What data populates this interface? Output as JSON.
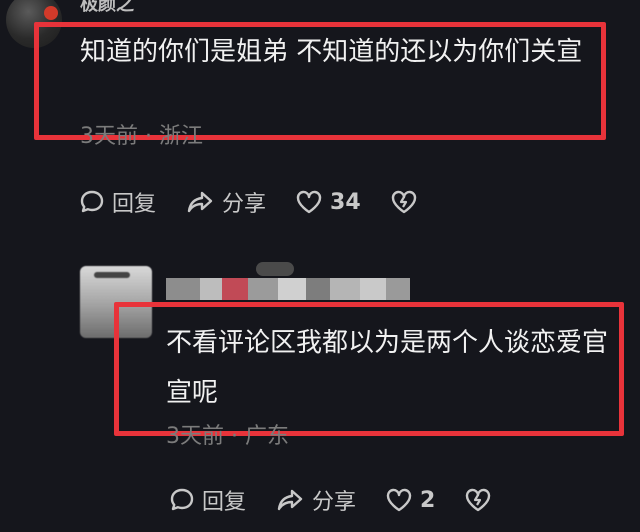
{
  "comments": [
    {
      "username": "极颜之",
      "text": "知道的你们是姐弟 不知道的还以为你们关宣",
      "meta": "3天前 · 浙江",
      "reply_label": "回复",
      "share_label": "分享",
      "likes": "34"
    },
    {
      "text": "不看评论区我都以为是两个人谈恋爱官宣呢",
      "meta": "3天前 · 广东",
      "reply_label": "回复",
      "share_label": "分享",
      "likes": "2"
    }
  ],
  "icons": {
    "reply": "comment-bubble-icon",
    "share": "share-arrow-icon",
    "like": "heart-icon",
    "dislike": "broken-heart-icon"
  },
  "colors": {
    "background": "#15161c",
    "highlight_box": "#e8333a",
    "meta_text": "#7b7b7b"
  }
}
